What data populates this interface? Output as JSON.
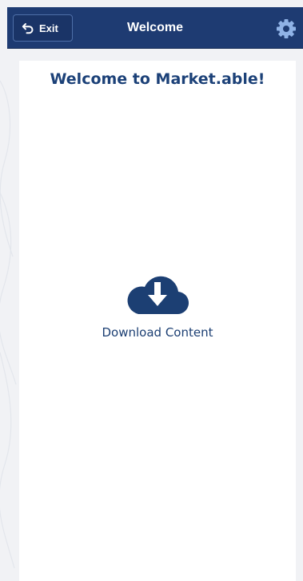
{
  "header": {
    "exit_label": "Exit",
    "title": "Welcome",
    "settings_icon": "gear-icon",
    "back_icon": "undo-arrow-icon"
  },
  "main": {
    "heading": "Welcome to Market.able!",
    "download_label": "Download Content",
    "download_icon": "cloud-download-icon"
  },
  "colors": {
    "header_bg": "#1e3b72",
    "accent": "#1c4178",
    "gear": "#8fb2e6",
    "background": "#f1f2f5"
  }
}
